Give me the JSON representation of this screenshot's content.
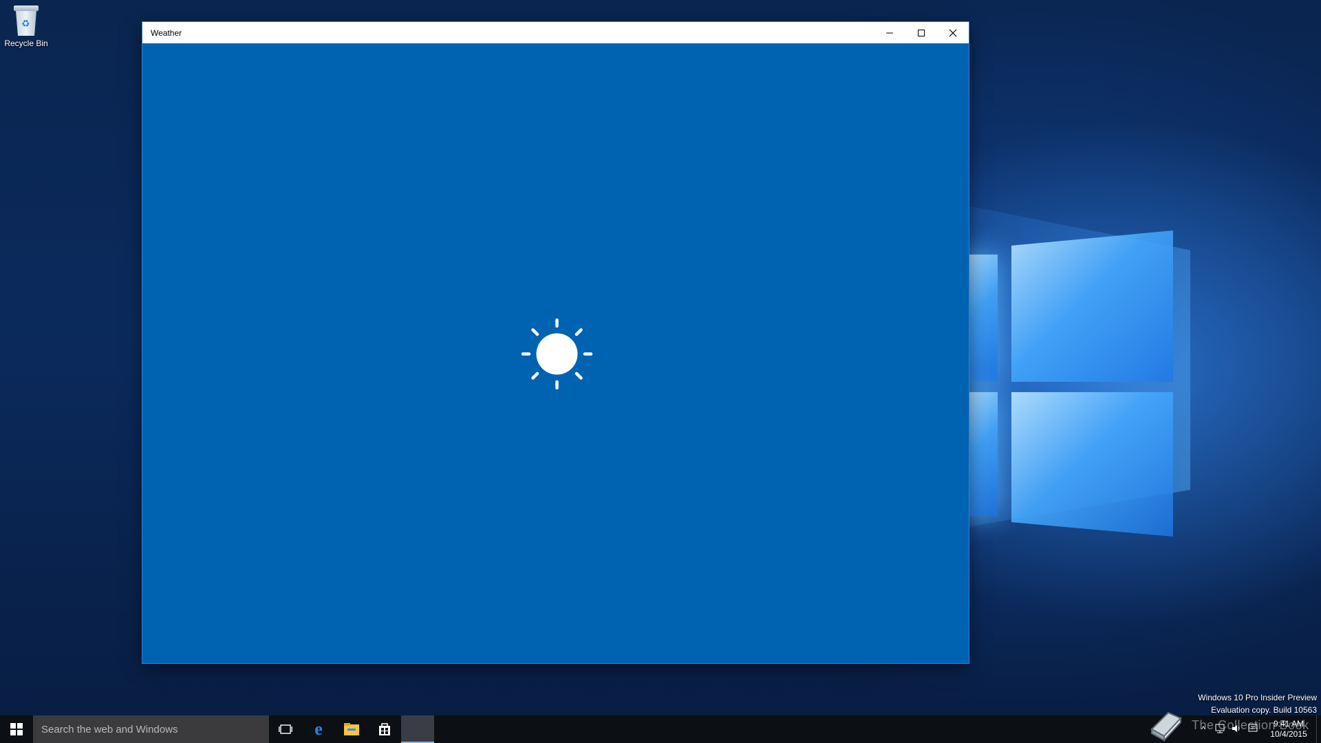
{
  "desktop": {
    "recycle_bin_label": "Recycle Bin",
    "watermark_line1": "Windows 10 Pro Insider Preview",
    "watermark_line2": "Evaluation copy. Build 10563"
  },
  "window": {
    "title": "Weather",
    "minimize_glyph": "—",
    "maximize_glyph": "☐",
    "close_glyph": "✕",
    "background_color": "#0063b1",
    "splash_icon": "sun-icon"
  },
  "taskbar": {
    "search_placeholder": "Search the web and Windows",
    "pinned": [
      "task-view-icon",
      "edge-icon",
      "file-explorer-icon",
      "store-icon",
      "weather-app-icon"
    ],
    "tray": {
      "time": "9:41 AM",
      "date": "10/4/2015"
    },
    "overlay_watermark": "The Collection Book"
  }
}
